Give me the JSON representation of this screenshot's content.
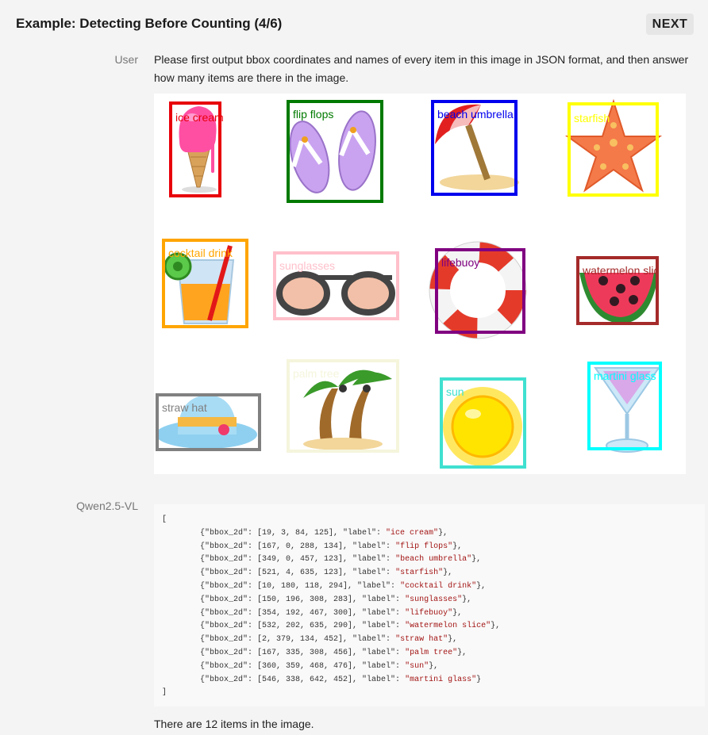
{
  "header": {
    "title": "Example: Detecting Before Counting (4/6)",
    "next_label": "NEXT"
  },
  "user": {
    "role": "User",
    "prompt": "Please first output bbox coordinates and names of every item in this image in JSON format, and then answer how many items are there in the image."
  },
  "image": {
    "detections": [
      {
        "label": "ice cream",
        "color": "#e8000b"
      },
      {
        "label": "flip flops",
        "color": "#007a00"
      },
      {
        "label": "beach umbrella",
        "color": "#0000ee"
      },
      {
        "label": "starfish",
        "color": "#ffff00"
      },
      {
        "label": "cocktail drink",
        "color": "#ffa500"
      },
      {
        "label": "sunglasses",
        "color": "#ffc0cb"
      },
      {
        "label": "lifebuoy",
        "color": "#800080"
      },
      {
        "label": "watermelon slice",
        "color": "#a52a2a"
      },
      {
        "label": "straw hat",
        "color": "#808080"
      },
      {
        "label": "palm tree",
        "color": "#f5f5dc"
      },
      {
        "label": "sun",
        "color": "#40e0d0"
      },
      {
        "label": "martini glass",
        "color": "#00ffff"
      }
    ]
  },
  "assistant": {
    "role": "Qwen2.5-VL",
    "code_lines": [
      "[",
      "        {\"bbox_2d\": [19, 3, 84, 125], \"label\": \"ice cream\"},",
      "        {\"bbox_2d\": [167, 0, 288, 134], \"label\": \"flip flops\"},",
      "        {\"bbox_2d\": [349, 0, 457, 123], \"label\": \"beach umbrella\"},",
      "        {\"bbox_2d\": [521, 4, 635, 123], \"label\": \"starfish\"},",
      "        {\"bbox_2d\": [10, 180, 118, 294], \"label\": \"cocktail drink\"},",
      "        {\"bbox_2d\": [150, 196, 308, 283], \"label\": \"sunglasses\"},",
      "        {\"bbox_2d\": [354, 192, 467, 300], \"label\": \"lifebuoy\"},",
      "        {\"bbox_2d\": [532, 202, 635, 290], \"label\": \"watermelon slice\"},",
      "        {\"bbox_2d\": [2, 379, 134, 452], \"label\": \"straw hat\"},",
      "        {\"bbox_2d\": [167, 335, 308, 456], \"label\": \"palm tree\"},",
      "        {\"bbox_2d\": [360, 359, 468, 476], \"label\": \"sun\"},",
      "        {\"bbox_2d\": [546, 338, 642, 452], \"label\": \"martini glass\"}",
      "]"
    ],
    "answer": "There are 12 items in the image."
  }
}
